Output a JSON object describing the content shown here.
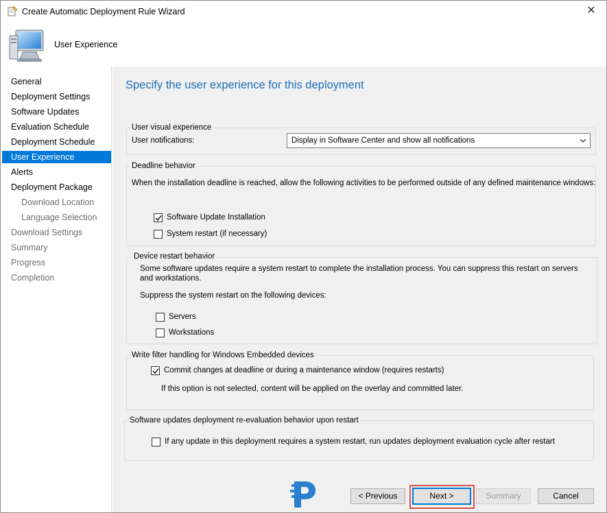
{
  "window": {
    "title": "Create Automatic Deployment Rule Wizard",
    "close_glyph": "✕",
    "icon": "wizard-icon"
  },
  "header": {
    "heading": "User Experience",
    "icon": "computer-icon"
  },
  "sidebar": {
    "items": [
      {
        "label": "General",
        "state": "normal"
      },
      {
        "label": "Deployment Settings",
        "state": "normal"
      },
      {
        "label": "Software Updates",
        "state": "normal"
      },
      {
        "label": "Evaluation Schedule",
        "state": "normal"
      },
      {
        "label": "Deployment Schedule",
        "state": "normal"
      },
      {
        "label": "User Experience",
        "state": "active"
      },
      {
        "label": "Alerts",
        "state": "normal"
      },
      {
        "label": "Deployment Package",
        "state": "normal"
      },
      {
        "label": "Download Location",
        "state": "disabled-sub"
      },
      {
        "label": "Language Selection",
        "state": "disabled-sub"
      },
      {
        "label": "Download Settings",
        "state": "disabled"
      },
      {
        "label": "Summary",
        "state": "disabled"
      },
      {
        "label": "Progress",
        "state": "disabled"
      },
      {
        "label": "Completion",
        "state": "disabled"
      }
    ]
  },
  "main": {
    "heading": "Specify the user experience for this deployment",
    "user_visual": {
      "legend": "User visual experience",
      "notifications_label": "User notifications:",
      "notifications_value": "Display in Software Center and show all notifications"
    },
    "deadline": {
      "legend": "Deadline behavior",
      "description": "When the installation deadline is reached, allow the following activities to be performed outside of any defined maintenance windows:",
      "software_update_installation": {
        "label": "Software Update Installation",
        "checked": true
      },
      "system_restart": {
        "label": "System restart (if necessary)",
        "checked": false
      }
    },
    "device_restart": {
      "legend": "Device restart behavior",
      "description": "Some software updates require a system restart to complete the installation process. You can suppress this restart on servers and workstations.",
      "suppress_label": "Suppress the system restart on the following devices:",
      "servers": {
        "label": "Servers",
        "checked": false
      },
      "workstations": {
        "label": "Workstations",
        "checked": false
      }
    },
    "write_filter": {
      "legend": "Write filter handling for Windows Embedded devices",
      "commit": {
        "label": "Commit changes at deadline or during a maintenance window (requires restarts)",
        "checked": true
      },
      "note": "If this option is not selected, content will be applied on the overlay and committed later."
    },
    "reevaluation": {
      "legend": "Software updates deployment re-evaluation behavior upon restart",
      "option": {
        "label": "If any update in this deployment requires a system restart, run updates deployment evaluation cycle after restart",
        "checked": false
      }
    }
  },
  "footer": {
    "previous_label": "< Previous",
    "next_label": "Next >",
    "summary_label": "Summary",
    "cancel_label": "Cancel",
    "logo": "p-logo-icon"
  },
  "colors": {
    "accent": "#0078d7",
    "heading": "#1f6fb5",
    "highlight": "#d9534f",
    "panel": "#f0f0f0"
  }
}
